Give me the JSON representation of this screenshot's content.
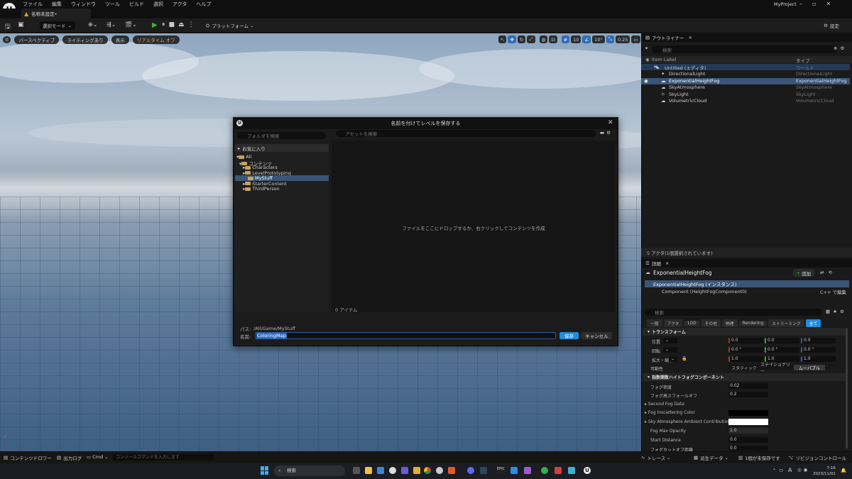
{
  "menu": [
    "ファイル",
    "編集",
    "ウィンドウ",
    "ツール",
    "ビルド",
    "選択",
    "アクタ",
    "ヘルプ"
  ],
  "project_name": "MyProject",
  "doc_tab": "名称未設定•",
  "toolbar": {
    "mode": "選択モード",
    "platform": "プラットフォーム",
    "settings": "設定"
  },
  "viewport": {
    "perspective": "パースペクティブ",
    "lighting": "ライティングあり",
    "show": "表示",
    "realtime": "リアルタイム オフ",
    "grid_snap": "10",
    "rot_snap": "10°",
    "scale_snap": "0.25",
    "camera_speed": "1"
  },
  "outliner": {
    "title": "アウトライナー",
    "search_placeholder": "検索",
    "col_label": "Item Label",
    "col_type": "タイプ",
    "rows": [
      {
        "label": "Untitled (エディタ)",
        "type": "ワールド"
      },
      {
        "label": "DirectionalLight",
        "type": "DirectionalLight"
      },
      {
        "label": "ExponentialHeightFog",
        "type": "ExponentialHeightFog"
      },
      {
        "label": "SkyAtmosphere",
        "type": "SkyAtmosphere"
      },
      {
        "label": "SkyLight",
        "type": "SkyLight"
      },
      {
        "label": "VolumetricCloud",
        "type": "VolumetricCloud"
      }
    ],
    "status": "5 アクタ(1個選択されています)"
  },
  "details": {
    "title": "詳細",
    "object": "ExponentialHeightFog",
    "add": "追加",
    "instance": "ExponentialHeightFog (インスタンス)",
    "component": "Component (HeightFogComponent0)",
    "cpp_edit": "C++ で編集",
    "search_placeholder": "検索",
    "filters": [
      "一般",
      "アクタ",
      "LOD",
      "その他",
      "物理",
      "Rendering",
      "ストリーミング",
      "全て"
    ],
    "transform_section": "トランスフォーム",
    "location_label": "位置",
    "rotation_label": "回転",
    "scale_label": "拡大・縮小",
    "location": [
      "0.0",
      "0.0",
      "0.0"
    ],
    "rotation": [
      "0.0 °",
      "0.0 °",
      "0.0 °"
    ],
    "scale": [
      "1.0",
      "1.0",
      "1.0"
    ],
    "mobility_label": "可動性",
    "mobility": [
      "スタティック",
      "ステイショナリー",
      "ムーバブル"
    ],
    "fog_section": "指数関数ハイトフォグコンポーネント",
    "fog_density_label": "フォグ密度",
    "fog_density": "0.02",
    "fog_falloff_label": "フォグ高さフォールオフ",
    "fog_falloff": "0.2",
    "second_fog": "Second Fog Data",
    "inscatter": "Fog Inscattering Color",
    "sky_contrib": "Sky Atmosphere Ambient Contribution Color...",
    "max_opacity_label": "Fog Max Opacity",
    "max_opacity": "1.0",
    "start_distance_label": "Start Distance",
    "start_distance": "0.0",
    "cutoff_label": "フォグカットオフ距離",
    "cutoff": "0.0",
    "colors": {
      "inscatter": "#000000",
      "sky_contrib": "#ffffff"
    }
  },
  "dialog": {
    "title": "名前を付けてレベルを保存する",
    "folder_search": "フォルダを検索",
    "asset_search": "アセットを検索",
    "favorites": "お気に入り",
    "tree": [
      {
        "label": "All",
        "indent": 0,
        "arrow": "▾"
      },
      {
        "label": "コンテンツ",
        "indent": 1,
        "arrow": "▾"
      },
      {
        "label": "Characters",
        "indent": 2,
        "arrow": "▸"
      },
      {
        "label": "LevelPrototyping",
        "indent": 2,
        "arrow": "▸"
      },
      {
        "label": "MyStuff",
        "indent": 2,
        "arrow": ""
      },
      {
        "label": "StarterContent",
        "indent": 2,
        "arrow": "▸"
      },
      {
        "label": "ThirdPerson",
        "indent": 2,
        "arrow": "▸"
      }
    ],
    "empty_hint": "ファイルをここにドロップするか、右クリックしてコンテンツを作成",
    "item_count": "0 アイテム",
    "path_label": "パス:",
    "path": "/All/Game/MyStuff",
    "name_label": "名前:",
    "name_value": "ColoringMap",
    "save": "保存",
    "cancel": "キャンセル"
  },
  "bottom": {
    "content_drawer": "コンテンツドロワー",
    "output_log": "出力ログ",
    "cmd": "Cmd",
    "console_placeholder": "コンソールコマンドを入力します",
    "trace": "トレース",
    "derived": "派生データ",
    "unsaved": "1個が未保存です",
    "source_control": "リビジョンコントロール"
  },
  "taskbar": {
    "search": "検索",
    "time": "7:16",
    "date": "2023/11/01",
    "ime": "A"
  }
}
